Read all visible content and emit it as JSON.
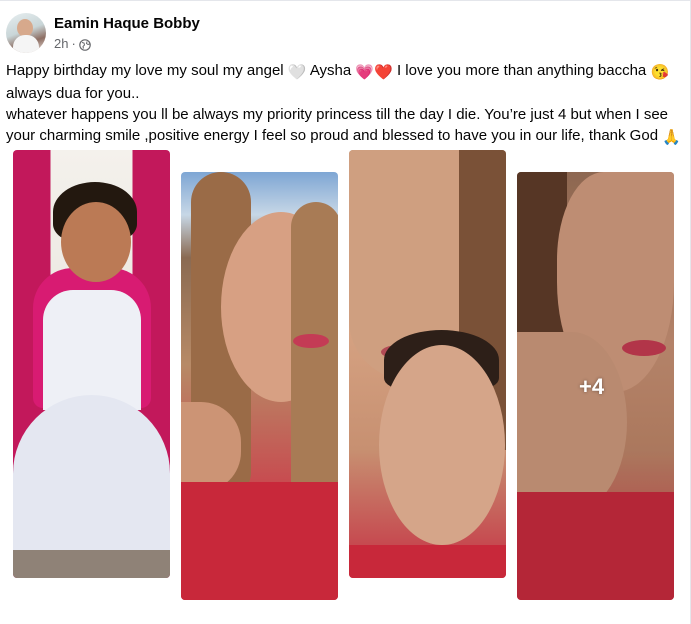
{
  "post": {
    "author": "Eamin Haque Bobby",
    "time": "2h",
    "separator": "·",
    "privacy_icon": "globe-icon",
    "text_line1_a": "Happy birthday my love my soul my angel ",
    "emoji_white_heart": "🤍",
    "text_line1_b": " Aysha ",
    "emoji_hearts": "💗❤️",
    "text_line1_c": " I love you more than anything baccha ",
    "emoji_kiss": "😘",
    "text_line2": "always dua for you..",
    "text_line3": "whatever happens you ll be always my priority princess till the day I die. You’re just 4 but when I see",
    "text_line4": "your charming smile ,positive energy I feel so proud and blessed to have you in our life, thank God ",
    "emoji_pray": "🙏",
    "more_photos": "+4"
  }
}
